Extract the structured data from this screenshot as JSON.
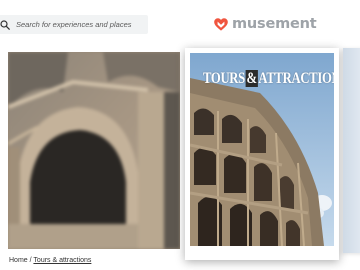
{
  "header": {
    "search": {
      "placeholder": "Search for experiences and places",
      "icon": "search-icon"
    },
    "logo": {
      "text": "musement",
      "mark": "heart-logo-icon",
      "color": "#f0553f",
      "text_color": "#9ea3a8"
    }
  },
  "hero": {
    "background_image": "colosseum-arches-blurred",
    "cover_card": {
      "title_left": "TOURS",
      "title_amp": "&",
      "title_right": "ATTRACTIONS",
      "image": "colosseum-under-blue-sky"
    }
  },
  "breadcrumb": {
    "home_label": "Home",
    "separator": "/",
    "current_label": "Tours & attractions"
  }
}
